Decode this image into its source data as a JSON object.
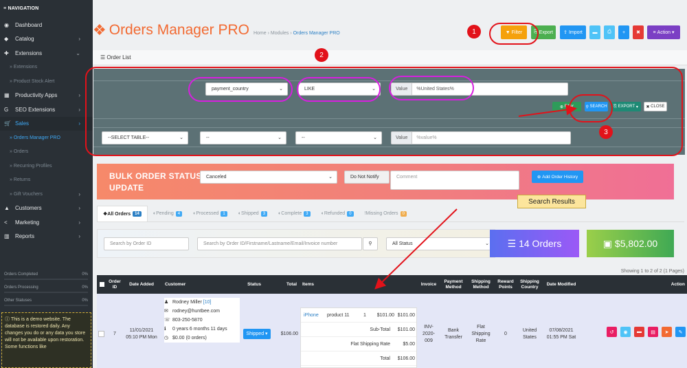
{
  "sidebar": {
    "heading": "NAVIGATION",
    "items": [
      {
        "label": "Dashboard",
        "icon": "dashboard-icon",
        "glyph": "◉"
      },
      {
        "label": "Catalog",
        "icon": "tag-icon",
        "glyph": "◆"
      },
      {
        "label": "Extensions",
        "icon": "puzzle-icon",
        "glyph": "✚"
      },
      {
        "label": "» Extensions"
      },
      {
        "label": "» Product Stock Alert"
      },
      {
        "label": "Productivity Apps",
        "icon": "box-icon",
        "glyph": "▦"
      },
      {
        "label": "SEO Extensions",
        "icon": "google-icon",
        "glyph": "G"
      },
      {
        "label": "Sales",
        "icon": "cart-icon",
        "glyph": "🛒"
      },
      {
        "label": "» Orders Manager PRO"
      },
      {
        "label": "» Orders"
      },
      {
        "label": "» Recurring Profiles"
      },
      {
        "label": "» Returns"
      },
      {
        "label": "» Gift Vouchers"
      },
      {
        "label": "Customers",
        "icon": "user-icon",
        "glyph": "▲"
      },
      {
        "label": "Marketing",
        "icon": "share-icon",
        "glyph": "<"
      },
      {
        "label": "Reports",
        "icon": "bar-chart-icon",
        "glyph": "▥"
      }
    ],
    "stats": [
      {
        "label": "Orders Completed",
        "value": "0%"
      },
      {
        "label": "Orders Processing",
        "value": "0%"
      },
      {
        "label": "Other Statuses",
        "value": "0%"
      }
    ],
    "demo_notice": "This is a demo website. The database is restored daily. Any changes you do or any data you store will not be available upon restoration. Some functions like"
  },
  "header": {
    "title": "Orders Manager PRO",
    "breadcrumb": [
      "Home",
      "Modules",
      "Orders Manager PRO"
    ],
    "buttons": {
      "filter": "Filter",
      "export": "Export",
      "import": "Import",
      "action": "Action"
    }
  },
  "order_list_label": "Order List",
  "filter": {
    "row1": {
      "field": "payment_country",
      "op": "LIKE",
      "value_label": "Value",
      "value": "%United States%"
    },
    "row2": {
      "table": "--SELECT TABLE--",
      "field": "--",
      "op": "--",
      "value_label": "Value",
      "placeholder": "%value%"
    },
    "add_filter": "Filter",
    "search": "SEARCH",
    "export": "EXPORT",
    "close": "CLOSE"
  },
  "bulk": {
    "title_line1": "BULK ORDER STATUS",
    "title_line2": "UPDATE",
    "status": "Canceled",
    "notify": "Do Not Notify",
    "comment_placeholder": "Comment",
    "button": "Add Order History"
  },
  "tabs": [
    {
      "label": "All Orders",
      "count": "14",
      "color": "#2b7fc4"
    },
    {
      "label": "Pending",
      "count": "4",
      "color": "#3fa9f5"
    },
    {
      "label": "Processed",
      "count": "1",
      "color": "#3fa9f5"
    },
    {
      "label": "Shipped",
      "count": "3",
      "color": "#3fa9f5"
    },
    {
      "label": "Complete",
      "count": "3",
      "color": "#3fa9f5"
    },
    {
      "label": "Refunded",
      "count": "0",
      "color": "#3fa9f5"
    },
    {
      "label": "Missing Orders",
      "count": "0",
      "color": "#f0ad4e"
    }
  ],
  "search": {
    "order_id_placeholder": "Search by Order ID",
    "general_placeholder": "Search by Order ID/Firstname/Lastname/Email/Invoice number",
    "status": "All Status"
  },
  "kpis": {
    "orders": "14 Orders",
    "total": "$5,802.00"
  },
  "showing": "Showing 1 to 2 of 2 (1 Pages)",
  "callout": "Search Results",
  "table": {
    "columns": [
      "Order ID",
      "Date Added",
      "Customer",
      "Status",
      "Total",
      "Items",
      "Invoice",
      "Payment Method",
      "Shipping Method",
      "Reward Points",
      "Shipping Country",
      "Date Modified",
      "Action"
    ],
    "row": {
      "id": "7",
      "date_added": "11/01/2021",
      "date_added_time": "05:10 PM Mon",
      "customer_name": "Rodney Miller",
      "customer_id": "[10]",
      "email": "rodney@huntbee.com",
      "phone": "803-250-5870",
      "age": "0 years 6 months 11 days",
      "orders": "$0.00 (0 orders)",
      "status": "Shipped",
      "total": "$106.00",
      "item_model": "iPhone",
      "item_name": "product 11",
      "item_qty": "1",
      "item_price": "$101.00",
      "item_total": "$101.00",
      "subtotal_label": "Sub-Total",
      "subtotal": "$101.00",
      "shipping_label": "Flat Shipping Rate",
      "shipping": "$5.00",
      "grand_label": "Total",
      "grand": "$106.00",
      "invoice": "INV-2020-009",
      "payment": "Bank Transfer",
      "shipping_method": "Flat Shipping Rate",
      "reward": "0",
      "country": "United States",
      "date_modified": "07/08/2021",
      "date_modified_time": "01:55 PM Sat"
    }
  },
  "annotations": [
    "1",
    "2",
    "3"
  ]
}
